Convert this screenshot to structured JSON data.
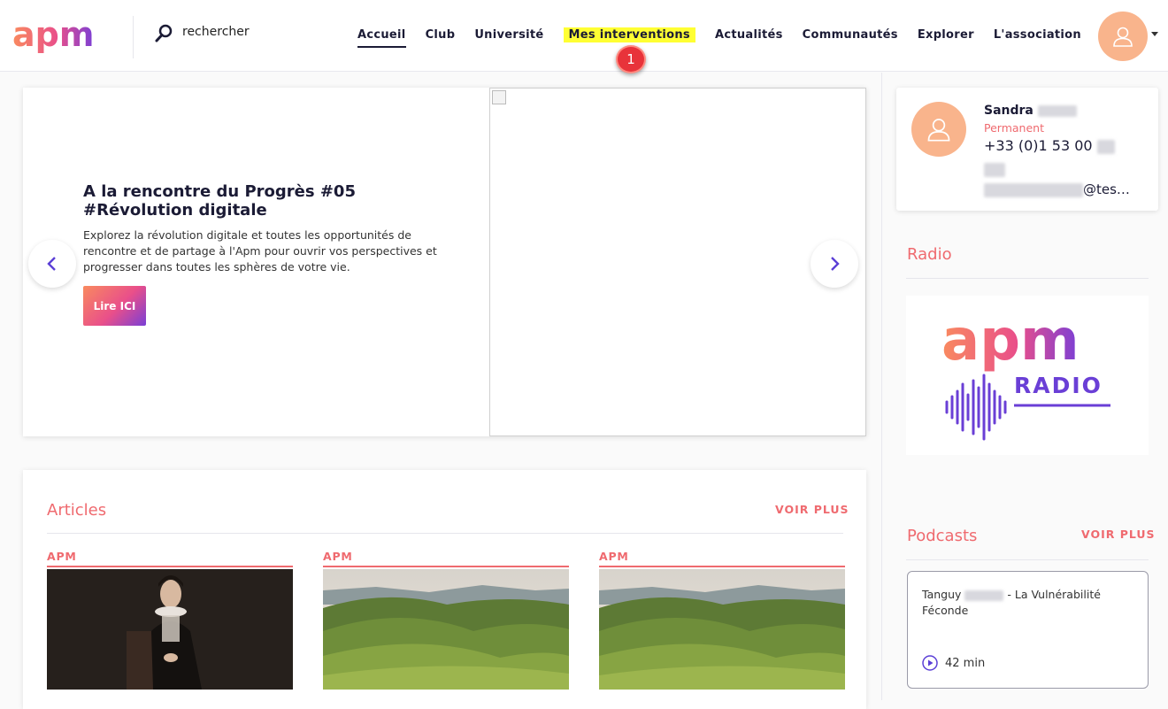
{
  "header": {
    "logo_text": "apm",
    "search_placeholder": "rechercher",
    "nav": [
      {
        "label": "Accueil"
      },
      {
        "label": "Club"
      },
      {
        "label": "Université"
      },
      {
        "label": "Mes interventions"
      },
      {
        "label": "Actualités"
      },
      {
        "label": "Communautés"
      },
      {
        "label": "Explorer"
      },
      {
        "label": "L'association"
      }
    ],
    "badge": "1"
  },
  "hero": {
    "title": "A la rencontre du Progrès #05 #Révolution digitale",
    "description": "Explorez la révolution digitale et toutes les opportunités de rencontre et de partage à l'Apm pour ouvrir vos perspectives et progresser dans toutes les sphères de votre vie.",
    "button_label": "Lire ICI"
  },
  "articles": {
    "title": "Articles",
    "see_more": "VOIR PLUS",
    "cards": [
      {
        "tag": "APM"
      },
      {
        "tag": "APM"
      },
      {
        "tag": "APM"
      }
    ]
  },
  "profile": {
    "name": "Sandra",
    "role": "Permanent",
    "phone": "+33 (0)1 53 00",
    "email_suffix": "@tes…"
  },
  "radio": {
    "title": "Radio",
    "logo_text": "apm",
    "logo_sub": "RADIO"
  },
  "podcasts": {
    "title": "Podcasts",
    "see_more": "VOIR PLUS",
    "item": {
      "title_prefix": "Tanguy",
      "title_suffix": "- La Vulnérabilité Féconde",
      "duration": "42 min"
    }
  },
  "colors": {
    "accent": "#ef6a6f",
    "highlight": "#ffff33",
    "avatar": "#f9b48c",
    "dark": "#1b1b35",
    "badge": "#e8333a"
  }
}
